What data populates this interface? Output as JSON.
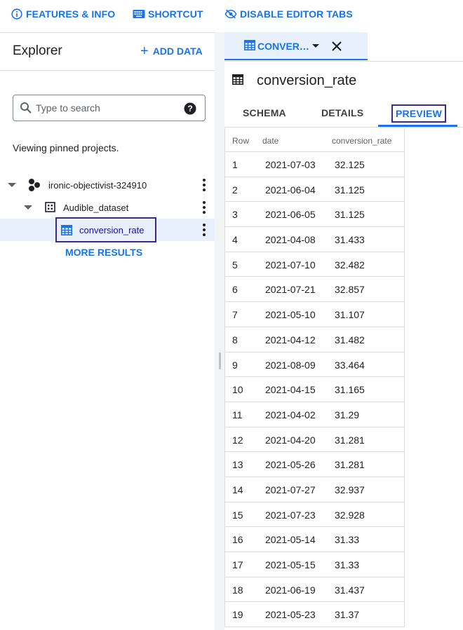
{
  "toolbar": {
    "features_label": "FEATURES & INFO",
    "shortcut_label": "SHORTCUT",
    "disable_tabs_label": "DISABLE EDITOR TABS"
  },
  "explorer": {
    "title": "Explorer",
    "add_data_label": "ADD DATA",
    "search_placeholder": "Type to search",
    "pinned_text": "Viewing pinned projects.",
    "project_name": "ironic-objectivist-324910",
    "dataset_name": "Audible_dataset",
    "table_name": "conversion_rate",
    "more_results_label": "MORE RESULTS"
  },
  "editor": {
    "tab_label": "CONVER…",
    "table_title": "conversion_rate",
    "tabs": {
      "schema": "SCHEMA",
      "details": "DETAILS",
      "preview": "PREVIEW"
    },
    "columns": [
      "Row",
      "date",
      "conversion_rate"
    ],
    "rows": [
      [
        "1",
        "2021-07-03",
        "32.125"
      ],
      [
        "2",
        "2021-06-04",
        "31.125"
      ],
      [
        "3",
        "2021-06-05",
        "31.125"
      ],
      [
        "4",
        "2021-04-08",
        "31.433"
      ],
      [
        "5",
        "2021-07-10",
        "32.482"
      ],
      [
        "6",
        "2021-07-21",
        "32.857"
      ],
      [
        "7",
        "2021-05-10",
        "31.107"
      ],
      [
        "8",
        "2021-04-12",
        "31.482"
      ],
      [
        "9",
        "2021-08-09",
        "33.464"
      ],
      [
        "10",
        "2021-04-15",
        "31.165"
      ],
      [
        "11",
        "2021-04-02",
        "31.29"
      ],
      [
        "12",
        "2021-04-20",
        "31.281"
      ],
      [
        "13",
        "2021-05-26",
        "31.281"
      ],
      [
        "14",
        "2021-07-27",
        "32.937"
      ],
      [
        "15",
        "2021-07-23",
        "32.928"
      ],
      [
        "16",
        "2021-05-14",
        "31.33"
      ],
      [
        "17",
        "2021-05-15",
        "31.33"
      ],
      [
        "18",
        "2021-06-19",
        "31.437"
      ],
      [
        "19",
        "2021-05-23",
        "31.37"
      ]
    ]
  },
  "colors": {
    "accent": "#1a73e8",
    "selected_row": "#e8f0fe",
    "highlight_outline": "#3c2a8a"
  }
}
